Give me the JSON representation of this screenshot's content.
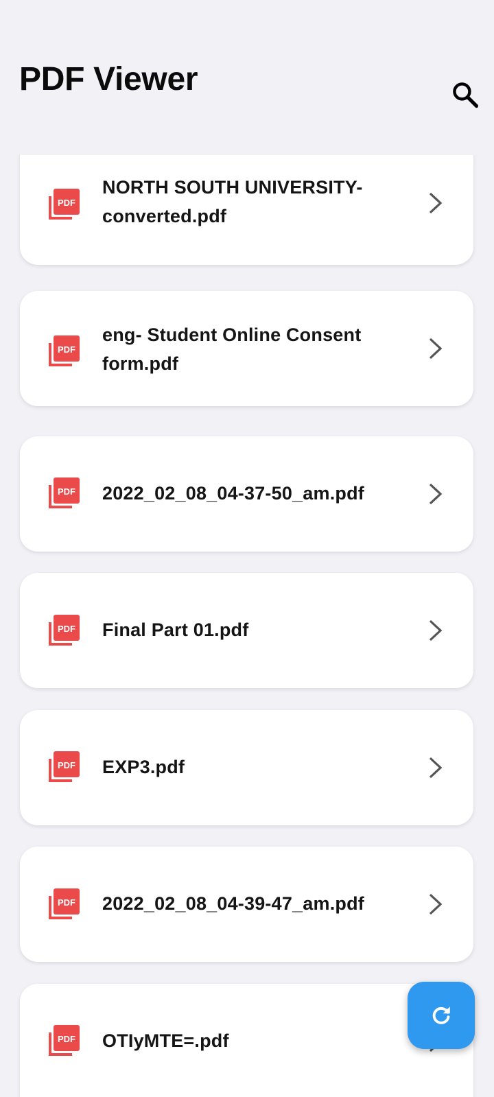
{
  "app_bar": {
    "title": "PDF Viewer",
    "search_icon": "search-icon"
  },
  "files": [
    {
      "name_line1": "NORTH SOUTH UNIVERSITY-",
      "name_line2": "converted.pdf",
      "icon": "pdf-file-icon"
    },
    {
      "name_line1": "eng- Student Online Consent",
      "name_line2": "form.pdf",
      "icon": "pdf-file-icon"
    },
    {
      "name": "2022_02_08_04-37-50_am.pdf",
      "icon": "pdf-file-icon"
    },
    {
      "name": "Final Part 01.pdf",
      "icon": "pdf-file-icon"
    },
    {
      "name": "EXP3.pdf",
      "icon": "pdf-file-icon"
    },
    {
      "name": "2022_02_08_04-39-47_am.pdf",
      "icon": "pdf-file-icon"
    },
    {
      "name": "OTIyMTE=.pdf",
      "icon": "pdf-file-icon"
    }
  ],
  "fab": {
    "icon": "refresh-icon"
  },
  "colors": {
    "background": "#f1f1f6",
    "card": "#ffffff",
    "pdf_red": "#ea4a4a",
    "fab_blue": "#2f98ef",
    "chevron": "#555555"
  }
}
